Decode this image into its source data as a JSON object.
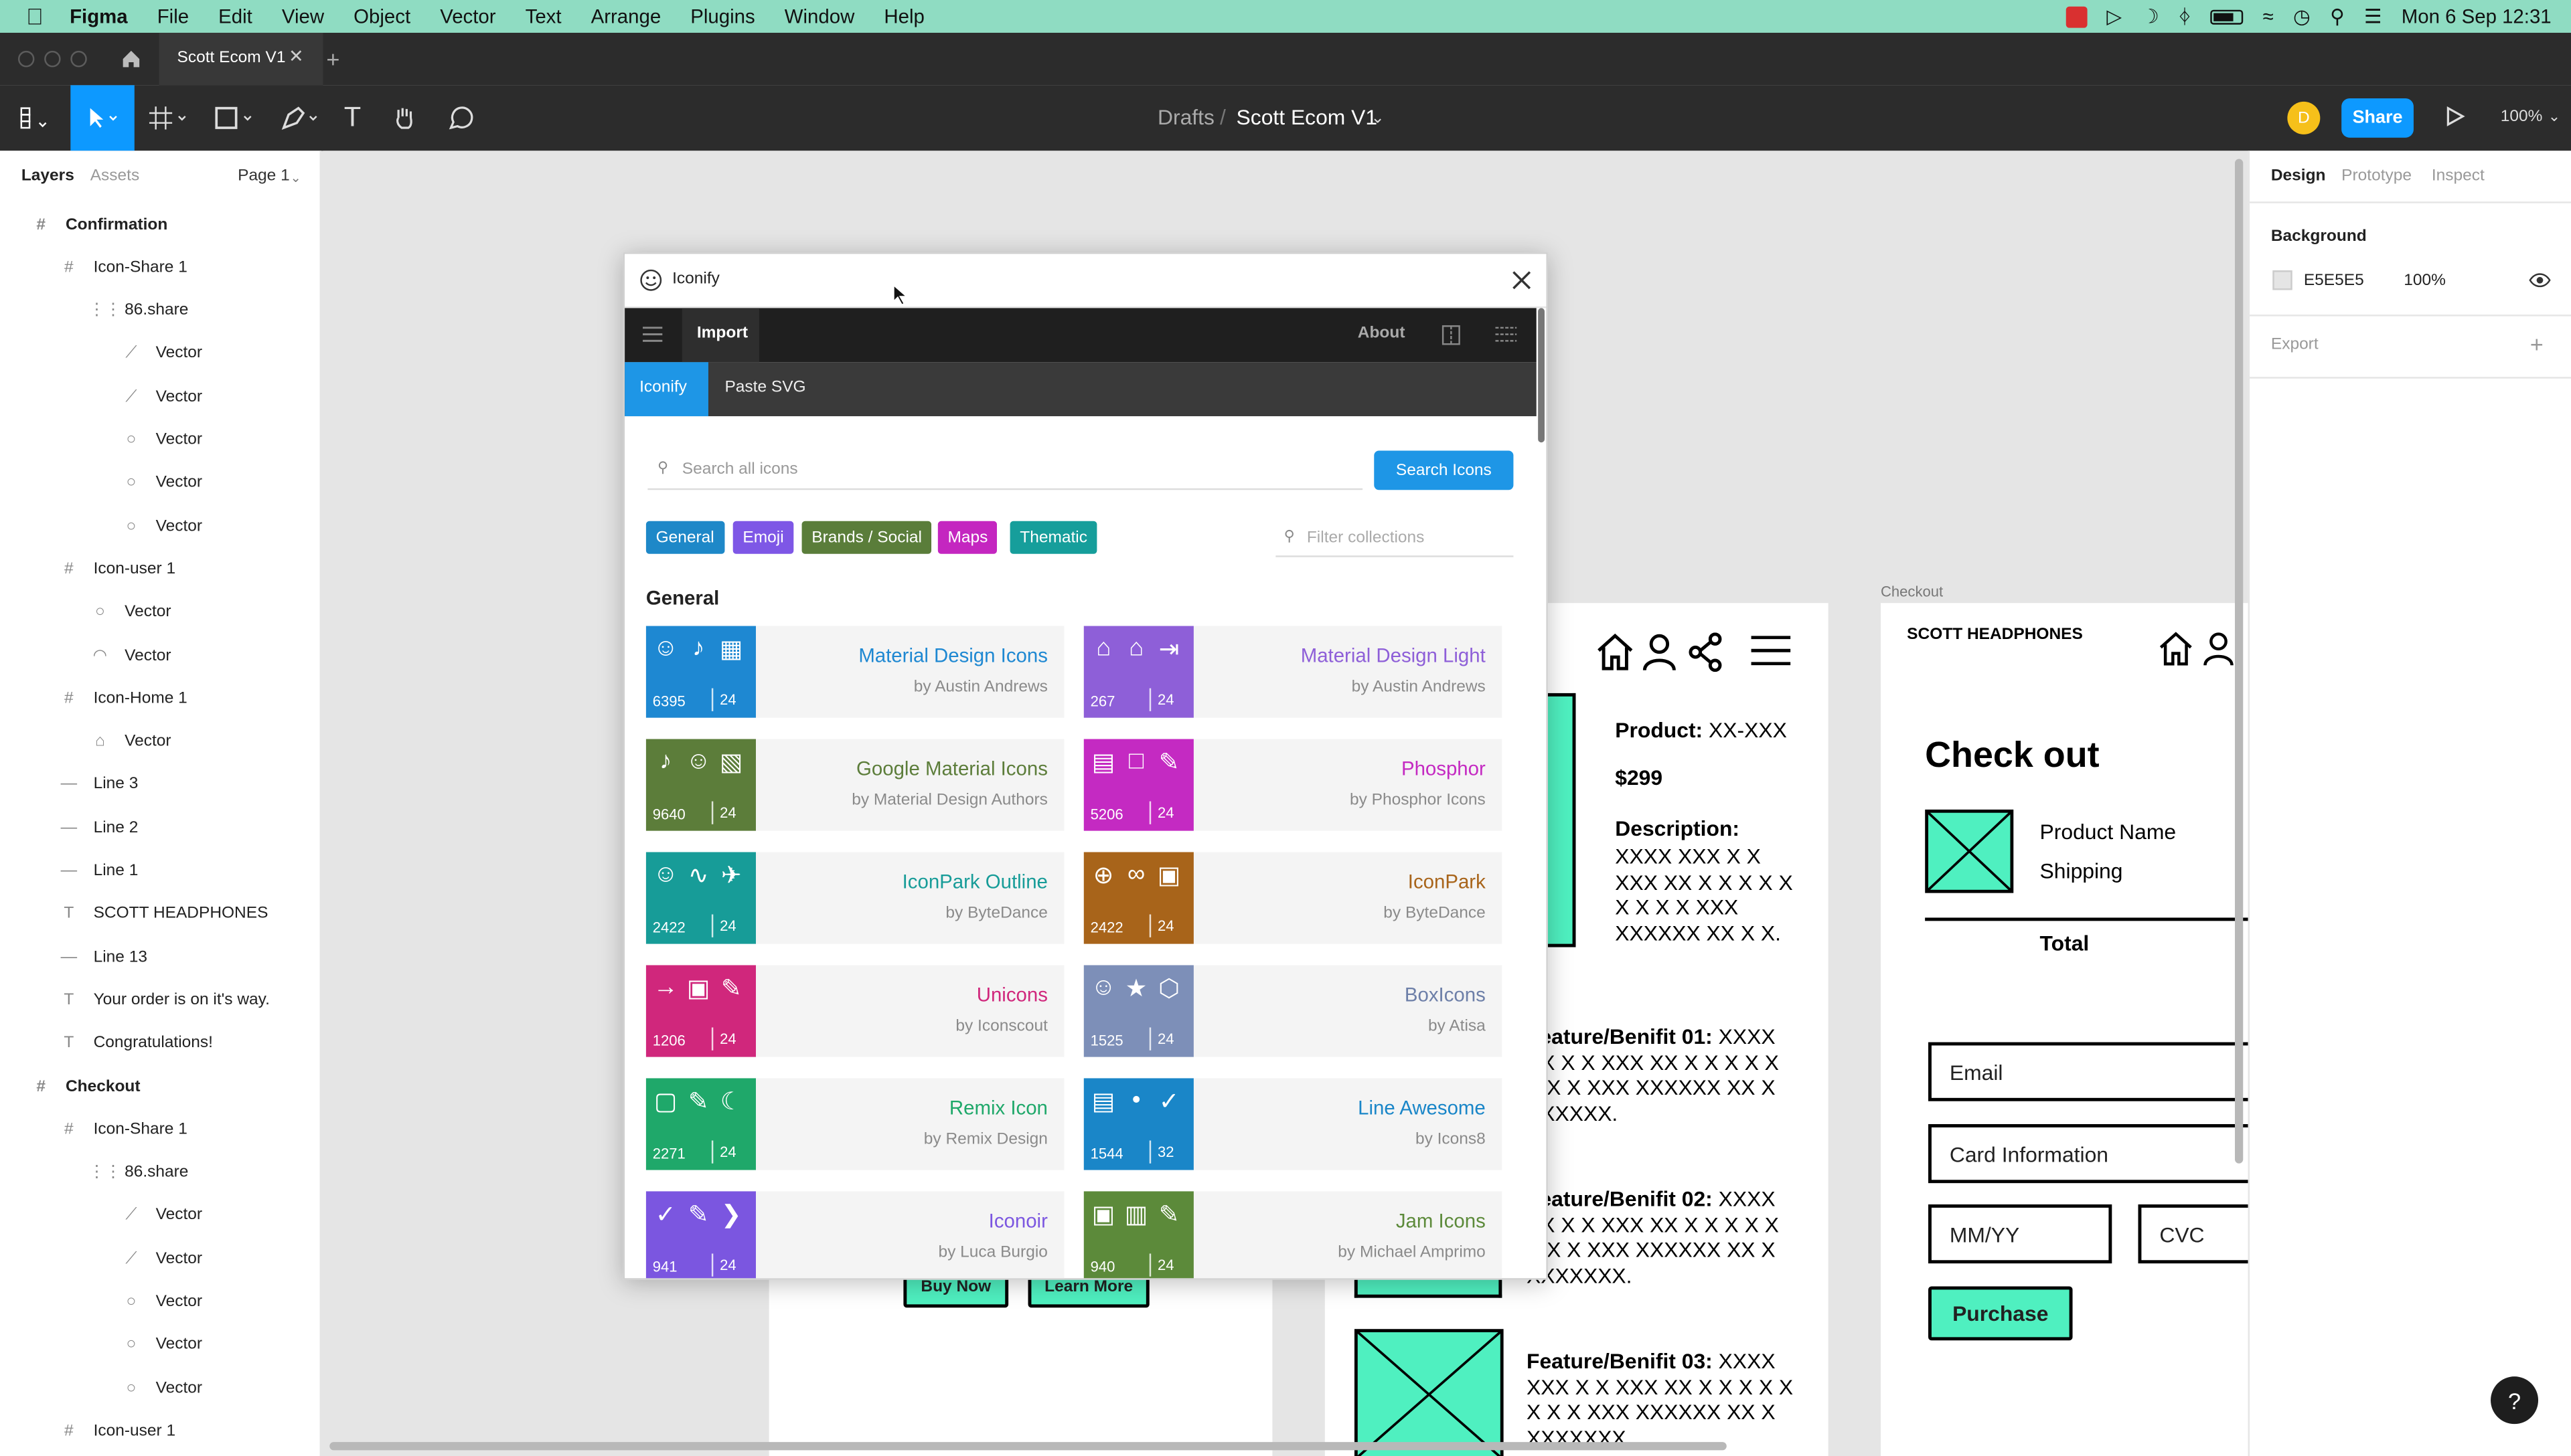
{
  "menubar": {
    "app_name": "Figma",
    "menus": [
      "File",
      "Edit",
      "View",
      "Object",
      "Vector",
      "Text",
      "Arrange",
      "Plugins",
      "Window",
      "Help"
    ],
    "datetime": "Mon 6 Sep  12:31"
  },
  "tabbar": {
    "file_tab": "Scott Ecom V1"
  },
  "toolbar": {
    "breadcrumb_parent": "Drafts",
    "breadcrumb_sep": "/",
    "file_title": "Scott Ecom V1",
    "avatar_initial": "D",
    "share_label": "Share",
    "zoom": "100%"
  },
  "left_panel": {
    "tab_layers": "Layers",
    "tab_assets": "Assets",
    "page": "Page 1",
    "layers": [
      {
        "icon": "#",
        "label": "Confirmation",
        "indent": 0
      },
      {
        "icon": "#",
        "label": "Icon-Share 1",
        "indent": 1
      },
      {
        "icon": "⋮⋮",
        "label": "86.share",
        "indent": 2
      },
      {
        "icon": "⟋",
        "label": "Vector",
        "indent": 3
      },
      {
        "icon": "⟋",
        "label": "Vector",
        "indent": 3
      },
      {
        "icon": "○",
        "label": "Vector",
        "indent": 3
      },
      {
        "icon": "○",
        "label": "Vector",
        "indent": 3
      },
      {
        "icon": "○",
        "label": "Vector",
        "indent": 3
      },
      {
        "icon": "#",
        "label": "Icon-user 1",
        "indent": 1
      },
      {
        "icon": "○",
        "label": "Vector",
        "indent": 2
      },
      {
        "icon": "◠",
        "label": "Vector",
        "indent": 2
      },
      {
        "icon": "#",
        "label": "Icon-Home 1",
        "indent": 1
      },
      {
        "icon": "⌂",
        "label": "Vector",
        "indent": 2
      },
      {
        "icon": "—",
        "label": "Line 3",
        "indent": 1
      },
      {
        "icon": "—",
        "label": "Line 2",
        "indent": 1
      },
      {
        "icon": "—",
        "label": "Line 1",
        "indent": 1
      },
      {
        "icon": "T",
        "label": "SCOTT HEADPHONES",
        "indent": 1
      },
      {
        "icon": "—",
        "label": "Line 13",
        "indent": 1
      },
      {
        "icon": "T",
        "label": "Your order is on it's way.",
        "indent": 1
      },
      {
        "icon": "T",
        "label": "Congratulations!",
        "indent": 1
      },
      {
        "icon": "#",
        "label": "Checkout",
        "indent": 0
      },
      {
        "icon": "#",
        "label": "Icon-Share 1",
        "indent": 1
      },
      {
        "icon": "⋮⋮",
        "label": "86.share",
        "indent": 2
      },
      {
        "icon": "⟋",
        "label": "Vector",
        "indent": 3
      },
      {
        "icon": "⟋",
        "label": "Vector",
        "indent": 3
      },
      {
        "icon": "○",
        "label": "Vector",
        "indent": 3
      },
      {
        "icon": "○",
        "label": "Vector",
        "indent": 3
      },
      {
        "icon": "○",
        "label": "Vector",
        "indent": 3
      },
      {
        "icon": "#",
        "label": "Icon-user 1",
        "indent": 1
      }
    ]
  },
  "right_panel": {
    "tabs": [
      "Design",
      "Prototype",
      "Inspect"
    ],
    "background_label": "Background",
    "background_hex": "E5E5E5",
    "background_opacity": "100%",
    "export_label": "Export",
    "swatch_color": "#e5e5e5"
  },
  "plugin": {
    "title": "Iconify",
    "nav_import": "Import",
    "nav_about": "About",
    "sub_iconify": "Iconify",
    "sub_paste": "Paste SVG",
    "search_placeholder": "Search all icons",
    "search_button": "Search Icons",
    "filter_placeholder": "Filter collections",
    "chips": [
      {
        "label": "General",
        "color": "#1e88c8"
      },
      {
        "label": "Emoji",
        "color": "#7e57e6"
      },
      {
        "label": "Brands / Social",
        "color": "#5a7d3a"
      },
      {
        "label": "Maps",
        "color": "#c426c0"
      },
      {
        "label": "Thematic",
        "color": "#169e9b"
      }
    ],
    "section_title": "General",
    "collections": [
      {
        "name": "Material Design Icons",
        "author": "by Austin Andrews",
        "count": "6395",
        "height": "24",
        "color": "#1e88d2",
        "name_color": "#1e88d2"
      },
      {
        "name": "Material Design Light",
        "author": "by Austin Andrews",
        "count": "267",
        "height": "24",
        "color": "#8e5fd8",
        "name_color": "#8e5fd8"
      },
      {
        "name": "Google Material Icons",
        "author": "by Material Design Authors",
        "count": "9640",
        "height": "24",
        "color": "#5c7d3a",
        "name_color": "#5c7d3a"
      },
      {
        "name": "Phosphor",
        "author": "by Phosphor Icons",
        "count": "5206",
        "height": "24",
        "color": "#c42ac2",
        "name_color": "#c42ac2"
      },
      {
        "name": "IconPark Outline",
        "author": "by ByteDance",
        "count": "2422",
        "height": "24",
        "color": "#179c98",
        "name_color": "#179c98"
      },
      {
        "name": "IconPark",
        "author": "by ByteDance",
        "count": "2422",
        "height": "24",
        "color": "#a8641a",
        "name_color": "#a8641a"
      },
      {
        "name": "Unicons",
        "author": "by Iconscout",
        "count": "1206",
        "height": "24",
        "color": "#d0277c",
        "name_color": "#d0277c"
      },
      {
        "name": "BoxIcons",
        "author": "by Atisa",
        "count": "1525",
        "height": "24",
        "color": "#7d8fb8",
        "name_color": "#6d7fa8"
      },
      {
        "name": "Remix Icon",
        "author": "by Remix Design",
        "count": "2271",
        "height": "24",
        "color": "#1fa86a",
        "name_color": "#1fa86a"
      },
      {
        "name": "Line Awesome",
        "author": "by Icons8",
        "count": "1544",
        "height": "32",
        "color": "#1a86c8",
        "name_color": "#1a86c8"
      },
      {
        "name": "Iconoir",
        "author": "by Luca Burgio",
        "count": "941",
        "height": "24",
        "color": "#7b56e0",
        "name_color": "#7b56e0"
      },
      {
        "name": "Jam Icons",
        "author": "by Michael Amprimo",
        "count": "940",
        "height": "24",
        "color": "#5c8a3a",
        "name_color": "#5c8a3a"
      }
    ]
  },
  "canvas": {
    "product": {
      "product_label": "Product:",
      "product_value": "XX-XXX",
      "price": "$299",
      "description_label": "Description:",
      "description_text": "XXXX XXX X X XXX XX X X X X X X X X X XXX XXXXXX XX X X.",
      "feature1_label": "Feature/Benifit 01:",
      "feature1_text": "XXXX XX X X XXX XX X X X X X X X X XXX XXXXXX XX X XXXXXX.",
      "feature2_label": "Feature/Benifit 02:",
      "feature2_text": "XXXX XX X X XXX XX X X X X X X X X XXX XXXXXX XX X XXXXXXX.",
      "feature3_label": "Feature/Benifit 03:",
      "feature3_text": "XXXX XXX X X XXX XX X X X X X X X X XXX XXXXXX XX X XXXXXXX.",
      "buy_now": "Buy Now",
      "learn_more": "Learn More"
    },
    "checkout": {
      "frame_label": "Checkout",
      "brand": "SCOTT HEADPHONES",
      "title": "Check out",
      "product_name": "Product Name",
      "shipping": "Shipping",
      "total": "Total",
      "email": "Email",
      "card": "Card Information",
      "mmyy": "MM/YY",
      "cvc": "CVC",
      "purchase": "Purchase"
    },
    "accent_color": "#4ff0c0"
  },
  "help_glyph": "?"
}
